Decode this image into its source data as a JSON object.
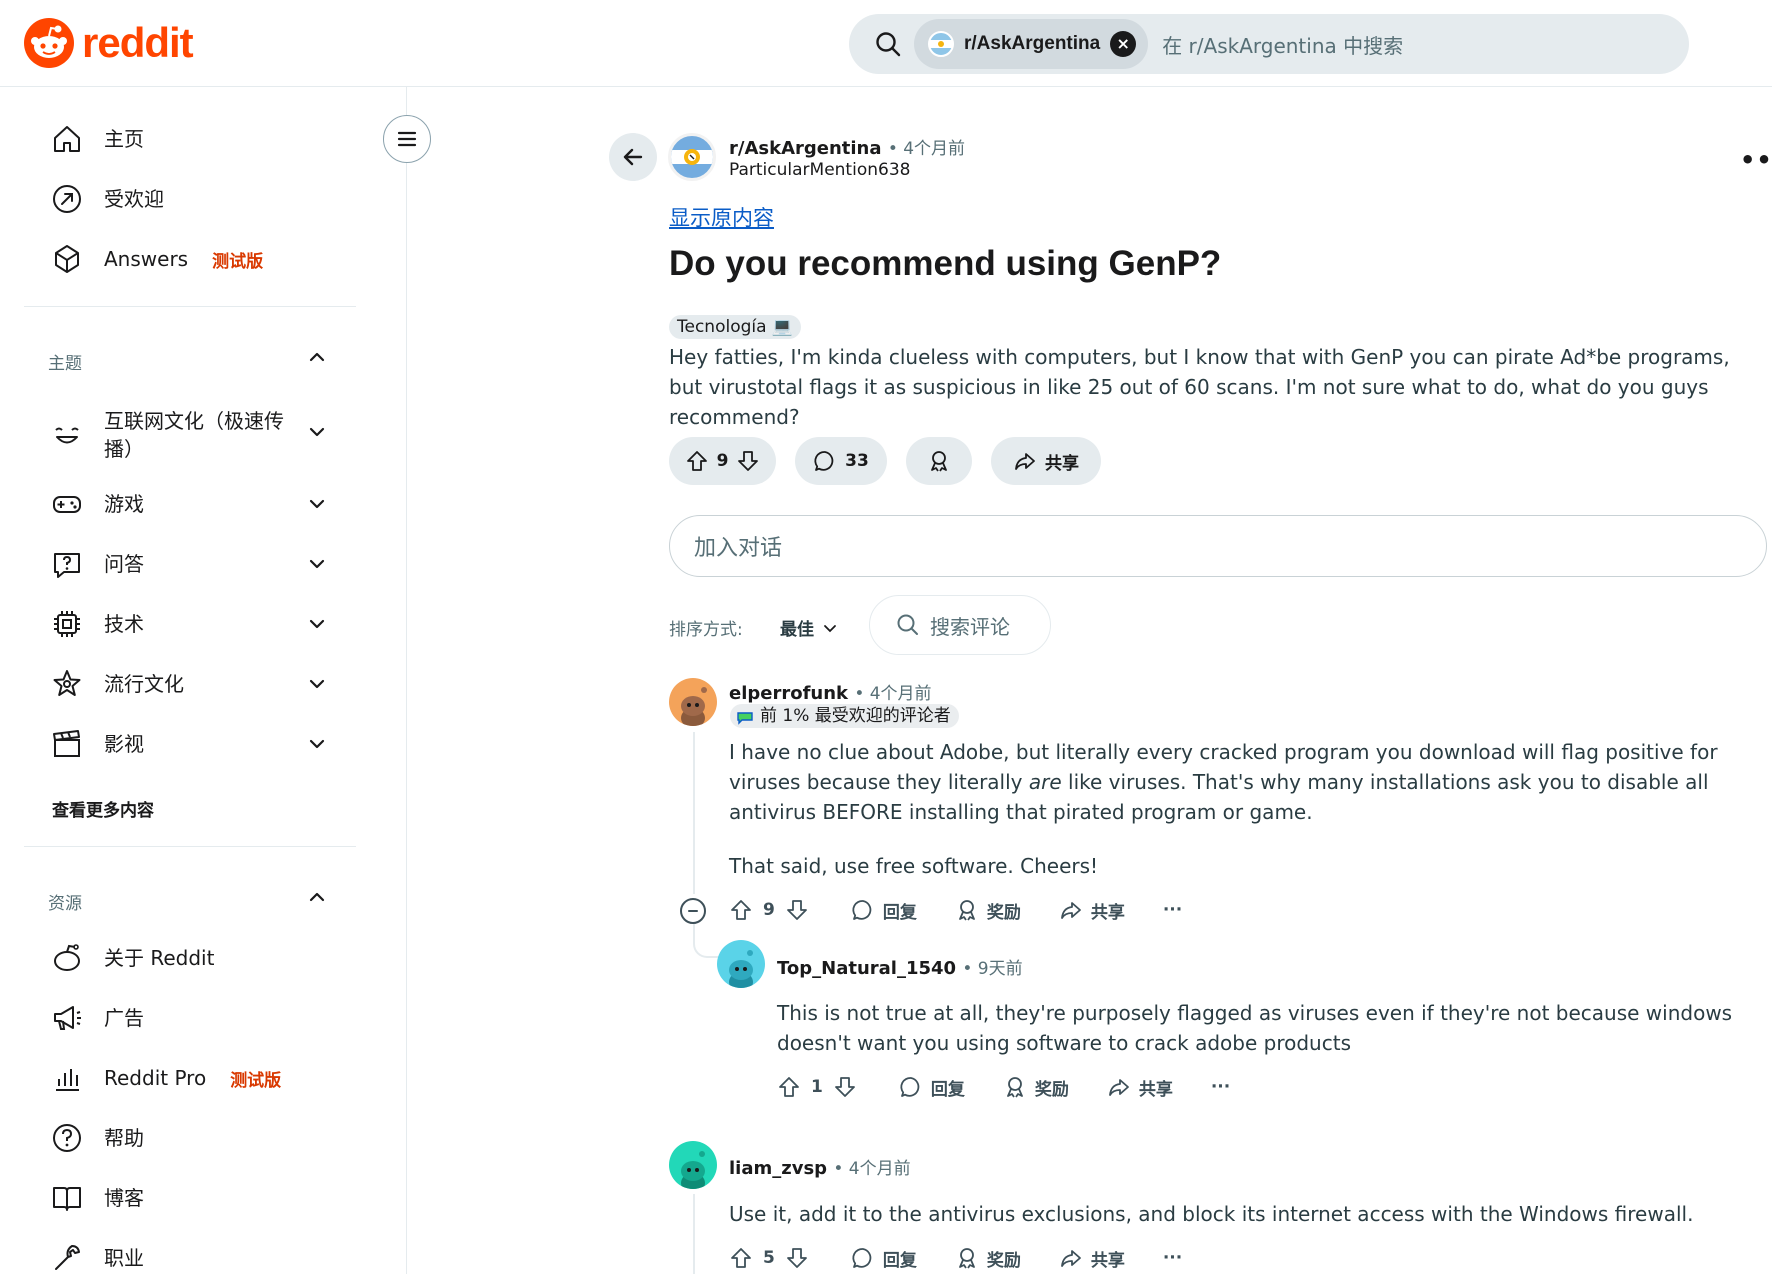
{
  "header": {
    "logo_text": "reddit",
    "search": {
      "chip_label": "r/AskArgentina",
      "chip_close": "×",
      "placeholder": "在 r/AskArgentina 中搜索"
    }
  },
  "sidebar": {
    "top_items": [
      {
        "label": "主页",
        "icon": "home-icon"
      },
      {
        "label": "受欢迎",
        "icon": "popular-icon"
      },
      {
        "label": "Answers",
        "icon": "answers-icon",
        "badge": "测试版"
      }
    ],
    "topics_title": "主题",
    "topics": [
      {
        "label": "互联网文化（极速传播）",
        "icon": "internet-culture-icon"
      },
      {
        "label": "游戏",
        "icon": "gamepad-icon"
      },
      {
        "label": "问答",
        "icon": "question-bubble-icon"
      },
      {
        "label": "技术",
        "icon": "chip-icon"
      },
      {
        "label": "流行文化",
        "icon": "star-icon"
      },
      {
        "label": "影视",
        "icon": "clapperboard-icon"
      }
    ],
    "see_more": "查看更多内容",
    "resources_title": "资源",
    "resources": [
      {
        "label": "关于 Reddit",
        "icon": "reddit-icon"
      },
      {
        "label": "广告",
        "icon": "megaphone-icon"
      },
      {
        "label": "Reddit Pro",
        "icon": "bar-chart-icon",
        "badge": "测试版"
      },
      {
        "label": "帮助",
        "icon": "help-icon"
      },
      {
        "label": "博客",
        "icon": "book-icon"
      },
      {
        "label": "职业",
        "icon": "wrench-icon"
      }
    ]
  },
  "post": {
    "subreddit": "r/AskArgentina",
    "time": "• 4个月前",
    "author": "ParticularMention638",
    "show_original": "显示原内容",
    "title": "Do you recommend using GenP?",
    "flair": "Tecnología 💻",
    "body": "Hey fatties, I'm kinda clueless with computers, but I know that with GenP you can pirate Ad*be programs, but virustotal flags it as suspicious in like 25 out of 60 scans. I'm not sure what to do, what do you guys recommend?",
    "votes": "9",
    "comments": "33",
    "share": "共享",
    "more": "•••"
  },
  "comment_box_placeholder": "加入对话",
  "sort": {
    "label": "排序方式:",
    "value": "最佳",
    "search_placeholder": "搜索评论"
  },
  "comments": [
    {
      "user": "elperrofunk",
      "time": "• 4个月前",
      "badge": "前 1% 最受欢迎的评论者",
      "text_before": "I have no clue about Adobe, but literally every cracked program you download will flag positive for viruses because they literally ",
      "text_em": "are",
      "text_after": " like viruses. That's why many installations ask you to disable all antivirus BEFORE installing that pirated program or game.",
      "text2": "That said, use free software. Cheers!",
      "votes": "9",
      "reply": "回复",
      "award": "奖励",
      "share": "共享",
      "more": "···"
    },
    {
      "user": "Top_Natural_1540",
      "time": "• 9天前",
      "text": "This is not true at all, they're purposely flagged as viruses even if they're not because windows doesn't want you using software to crack adobe products",
      "votes": "1",
      "reply": "回复",
      "award": "奖励",
      "share": "共享",
      "more": "···"
    },
    {
      "user": "liam_zvsp",
      "time": "• 4个月前",
      "text": "Use it, add it to the antivirus exclusions, and block its internet access with the Windows firewall.",
      "votes": "5",
      "reply": "回复",
      "award": "奖励",
      "share": "共享",
      "more": "···"
    }
  ],
  "colors": {
    "brand": "#ff4500",
    "link": "#0a5cc7",
    "beta": "#d93900",
    "pill_bg": "#e5ebee"
  }
}
